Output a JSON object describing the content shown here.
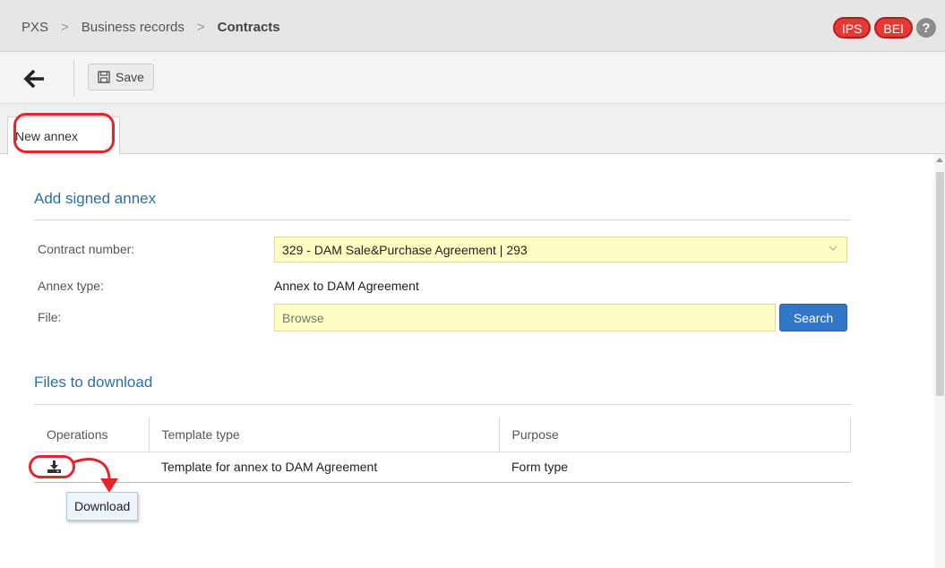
{
  "breadcrumb": [
    "PXS",
    "Business records",
    "Contracts"
  ],
  "badges": [
    "IPS",
    "BEI"
  ],
  "help_symbol": "?",
  "toolbar": {
    "save_label": "Save"
  },
  "tab": {
    "label": "New annex"
  },
  "form": {
    "title": "Add signed annex",
    "contract_label": "Contract number:",
    "contract_value": "329 - DAM Sale&Purchase Agreement | 293",
    "annex_type_label": "Annex type:",
    "annex_type_value": "Annex to DAM Agreement",
    "file_label": "File:",
    "file_placeholder": "Browse",
    "search_label": "Search"
  },
  "downloads": {
    "title": "Files to download",
    "columns": [
      "Operations",
      "Template type",
      "Purpose"
    ],
    "rows": [
      {
        "template_type": "Template for annex to DAM Agreement",
        "purpose": "Form type"
      }
    ],
    "tooltip": "Download"
  },
  "colors": {
    "accent_blue": "#2f6fa5",
    "button_blue": "#3276c8",
    "highlight_red": "#e3262b",
    "field_yellow": "#ffffc4"
  },
  "icons": [
    "arrow-left-icon",
    "save-icon",
    "chevron-down-icon",
    "download-icon",
    "help-icon"
  ]
}
